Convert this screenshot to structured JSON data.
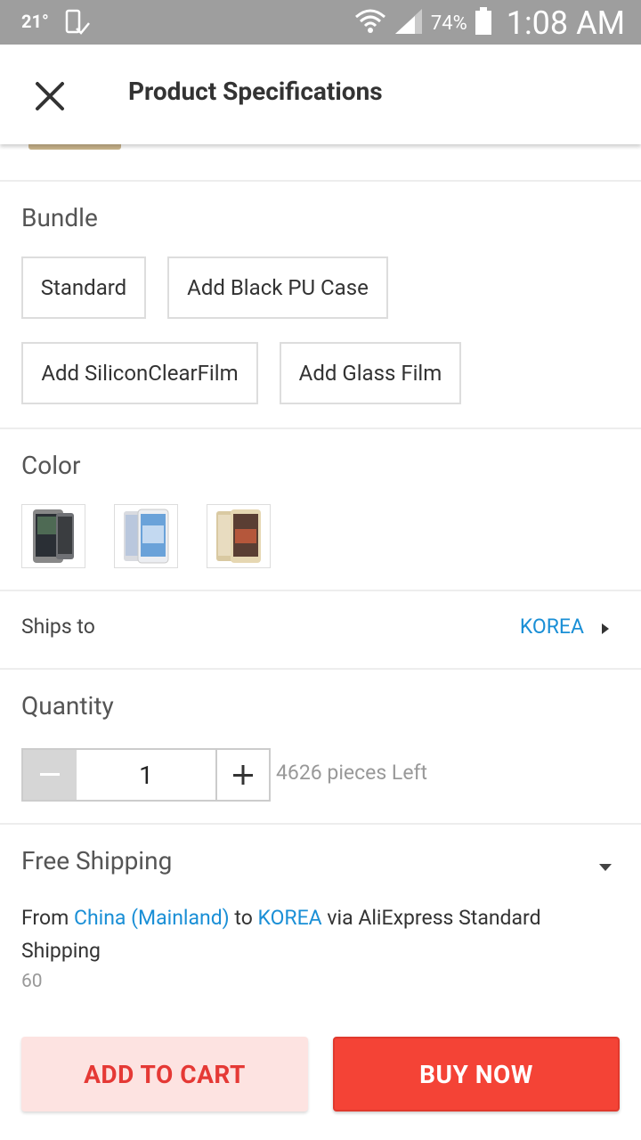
{
  "status_bar": {
    "temperature": "21°",
    "battery_percent": "74%",
    "time": "1:08 AM"
  },
  "header": {
    "title": "Product Specifications"
  },
  "bundle": {
    "label": "Bundle",
    "options": [
      "Standard",
      "Add Black PU Case",
      "Add SiliconClearFilm",
      "Add Glass Film"
    ]
  },
  "color": {
    "label": "Color",
    "swatches": [
      "gray-phone-icon",
      "white-phone-icon",
      "gold-phone-icon"
    ]
  },
  "shipping_dest": {
    "label": "Ships to",
    "value": "KOREA"
  },
  "quantity": {
    "label": "Quantity",
    "value": "1",
    "stock": "4626 pieces Left"
  },
  "shipping": {
    "method": "Free Shipping",
    "from_text": "From ",
    "origin": "China (Mainland)",
    "to_text": " to ",
    "destination": "KOREA",
    "via_text": " via AliExpress Standard Shipping",
    "delivery_time": "60"
  },
  "actions": {
    "add_to_cart": "ADD TO CART",
    "buy_now": "BUY NOW"
  },
  "colors": {
    "accent_blue": "#1a8fd6",
    "buy_red": "#f44336",
    "cart_pink": "#fde3e1"
  }
}
